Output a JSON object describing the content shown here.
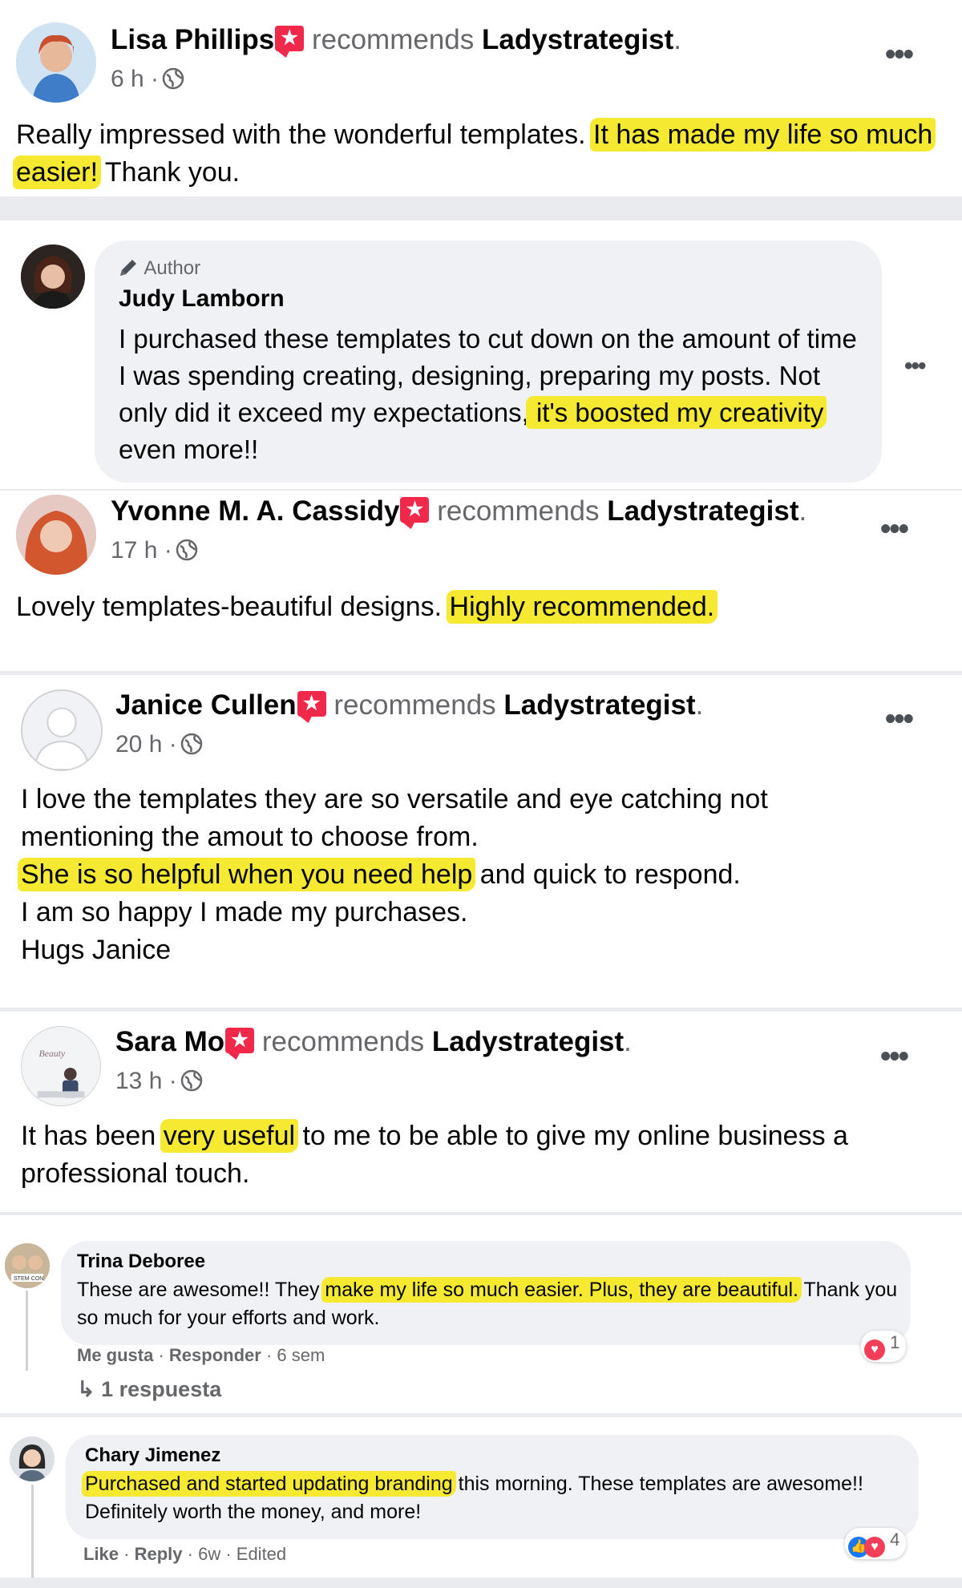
{
  "posts": [
    {
      "name": "Lisa Phillips",
      "recommends": "recommends",
      "page": "Ladystrategist",
      "time": "6 h ·",
      "text_before": "Really impressed with the wonderful templates. ",
      "highlight": "It has made my life so much easier!",
      "text_after": " Thank you."
    },
    {
      "name": "Yvonne M. A. Cassidy",
      "recommends": "recommends",
      "page": "Ladystrategist",
      "time": "17 h ·",
      "text_before": "Lovely templates-beautiful designs. ",
      "highlight": "Highly recommended.",
      "text_after": ""
    },
    {
      "name": "Janice Cullen",
      "recommends": "recommends",
      "page": "Ladystrategist",
      "time": "20 h ·",
      "line1": "I love the templates they are so versatile and eye catching not",
      "line2": "mentioning the amout to choose from.",
      "highlight": "She is so helpful when you need help",
      "line3_after": " and quick to respond.",
      "line4": "I am so happy I made my purchases.",
      "line5": "Hugs Janice"
    },
    {
      "name": "Sara Mo",
      "recommends": "recommends",
      "page": "Ladystrategist",
      "time": "13 h ·",
      "text_before": "It has been ",
      "highlight": "very useful",
      "text_after": " to me to be able to give my online business a professional touch."
    }
  ],
  "author_reply": {
    "tag": "Author",
    "name": "Judy Lamborn",
    "text_before": "I purchased these templates to cut down on the amount of time I was spending creating, designing, preparing my posts. Not only did it exceed my expectations,",
    "highlight": " it's boosted my creativity",
    "text_after": " even more!!"
  },
  "comments": [
    {
      "name": "Trina Deboree",
      "text_before": "These are awesome!! They ",
      "highlight": "make my life so much easier. Plus, they are beautiful.",
      "text_after": " Thank you so much for your efforts and work.",
      "like": "Me gusta",
      "reply": "Responder",
      "time": "6 sem",
      "reaction_count": "1",
      "replies_link": "1 respuesta"
    },
    {
      "name": "Chary Jimenez",
      "highlight": "Purchased and started updating branding",
      "text_after": " this morning. These templates are awesome!! Definitely worth the money, and more!",
      "like": "Like",
      "reply": "Reply",
      "time": "6w",
      "edited": "Edited",
      "reaction_count": "4"
    }
  ],
  "colors": {
    "highlight": "#f6e932",
    "flag": "#f02849",
    "bubble": "#eff1f5",
    "secondary_text": "#65676b"
  }
}
